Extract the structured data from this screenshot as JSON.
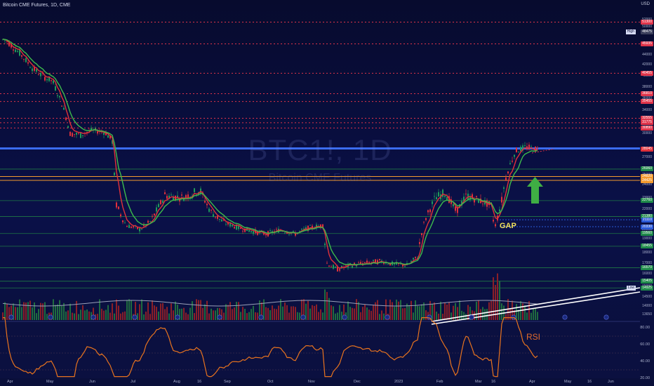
{
  "header": {
    "title": "Bitcoin CME Futures, 1D, CME",
    "currency": "USD"
  },
  "watermark": {
    "symbol": "BTC1!, 1D",
    "name": "Bitcoin CME Futures"
  },
  "colors": {
    "background": "#0a0f35",
    "up_candle": "#1f9a5a",
    "down_candle": "#e0313a",
    "ema_fast": "#e0313a",
    "ema_slow": "#3dbb4c",
    "rsi_line": "#e8731e",
    "blue_line": "#3b6cf0",
    "orange_line": "#f29a2e",
    "green_arrow": "#3fae44",
    "dotted_red": "#e0344a"
  },
  "price_axis": {
    "ticks": [
      "52000",
      "50000",
      "48000",
      "46000",
      "44000",
      "42000",
      "40000",
      "38000",
      "36000",
      "34000",
      "32000",
      "30000",
      "28000",
      "27000",
      "26000",
      "25000",
      "24000",
      "23000",
      "22000",
      "21000",
      "20000",
      "19000",
      "18000",
      "17000",
      "16000",
      "15000",
      "14500",
      "14000",
      "13650"
    ],
    "badges": [
      {
        "text": "51300",
        "color": "#e0344a",
        "price": 51300
      },
      {
        "text": "48475",
        "color": "#3b3f5c",
        "price": 48475
      },
      {
        "text": "45935",
        "color": "#e0344a",
        "price": 45935
      },
      {
        "text": "40455",
        "color": "#e0344a",
        "price": 40455
      },
      {
        "text": "36810",
        "color": "#e0344a",
        "price": 36810
      },
      {
        "text": "35455",
        "color": "#e0344a",
        "price": 35455
      },
      {
        "text": "32555",
        "color": "#e0344a",
        "price": 32555
      },
      {
        "text": "31775",
        "color": "#e0344a",
        "price": 31775
      },
      {
        "text": "30890",
        "color": "#e0344a",
        "price": 30890
      },
      {
        "text": "28045",
        "color": "#e0313a",
        "price": 28045
      },
      {
        "text": "26060",
        "color": "#1f8a4a",
        "price": 26060
      },
      {
        "text": "24820",
        "color": "#f29a2e",
        "price": 24820
      },
      {
        "text": "24425",
        "color": "#f29a2e",
        "price": 24425
      },
      {
        "text": "22760",
        "color": "#1f8a4a",
        "price": 22760
      },
      {
        "text": "21380",
        "color": "#1f8a4a",
        "price": 21380
      },
      {
        "text": "21110",
        "color": "#2b5ad8",
        "price": 21110
      },
      {
        "text": "20330",
        "color": "#2b5ad8",
        "price": 20330
      },
      {
        "text": "19560",
        "color": "#1f8a4a",
        "price": 19560
      },
      {
        "text": "18455",
        "color": "#1f8a4a",
        "price": 18455
      },
      {
        "text": "16570",
        "color": "#1f8a4a",
        "price": 16570
      },
      {
        "text": "15405",
        "color": "#1f8a4a",
        "price": 15405
      },
      {
        "text": "14925",
        "color": "#1f8a4a",
        "price": 14925
      }
    ],
    "high_tag": "High",
    "low_tag": "Low"
  },
  "timeline": {
    "labels": [
      "Apr",
      "May",
      "Jun",
      "Jul",
      "Aug",
      "16",
      "Sep",
      "Oct",
      "Nov",
      "Dec",
      "2023",
      "Feb",
      "Mar",
      "16",
      "Apr",
      "May",
      "16",
      "Jun"
    ]
  },
  "annotations": {
    "gap": "GAP",
    "rsi": "RSI"
  },
  "rsi_axis": {
    "ticks": [
      "80.00",
      "60.00",
      "40.00",
      "20.00"
    ]
  }
}
